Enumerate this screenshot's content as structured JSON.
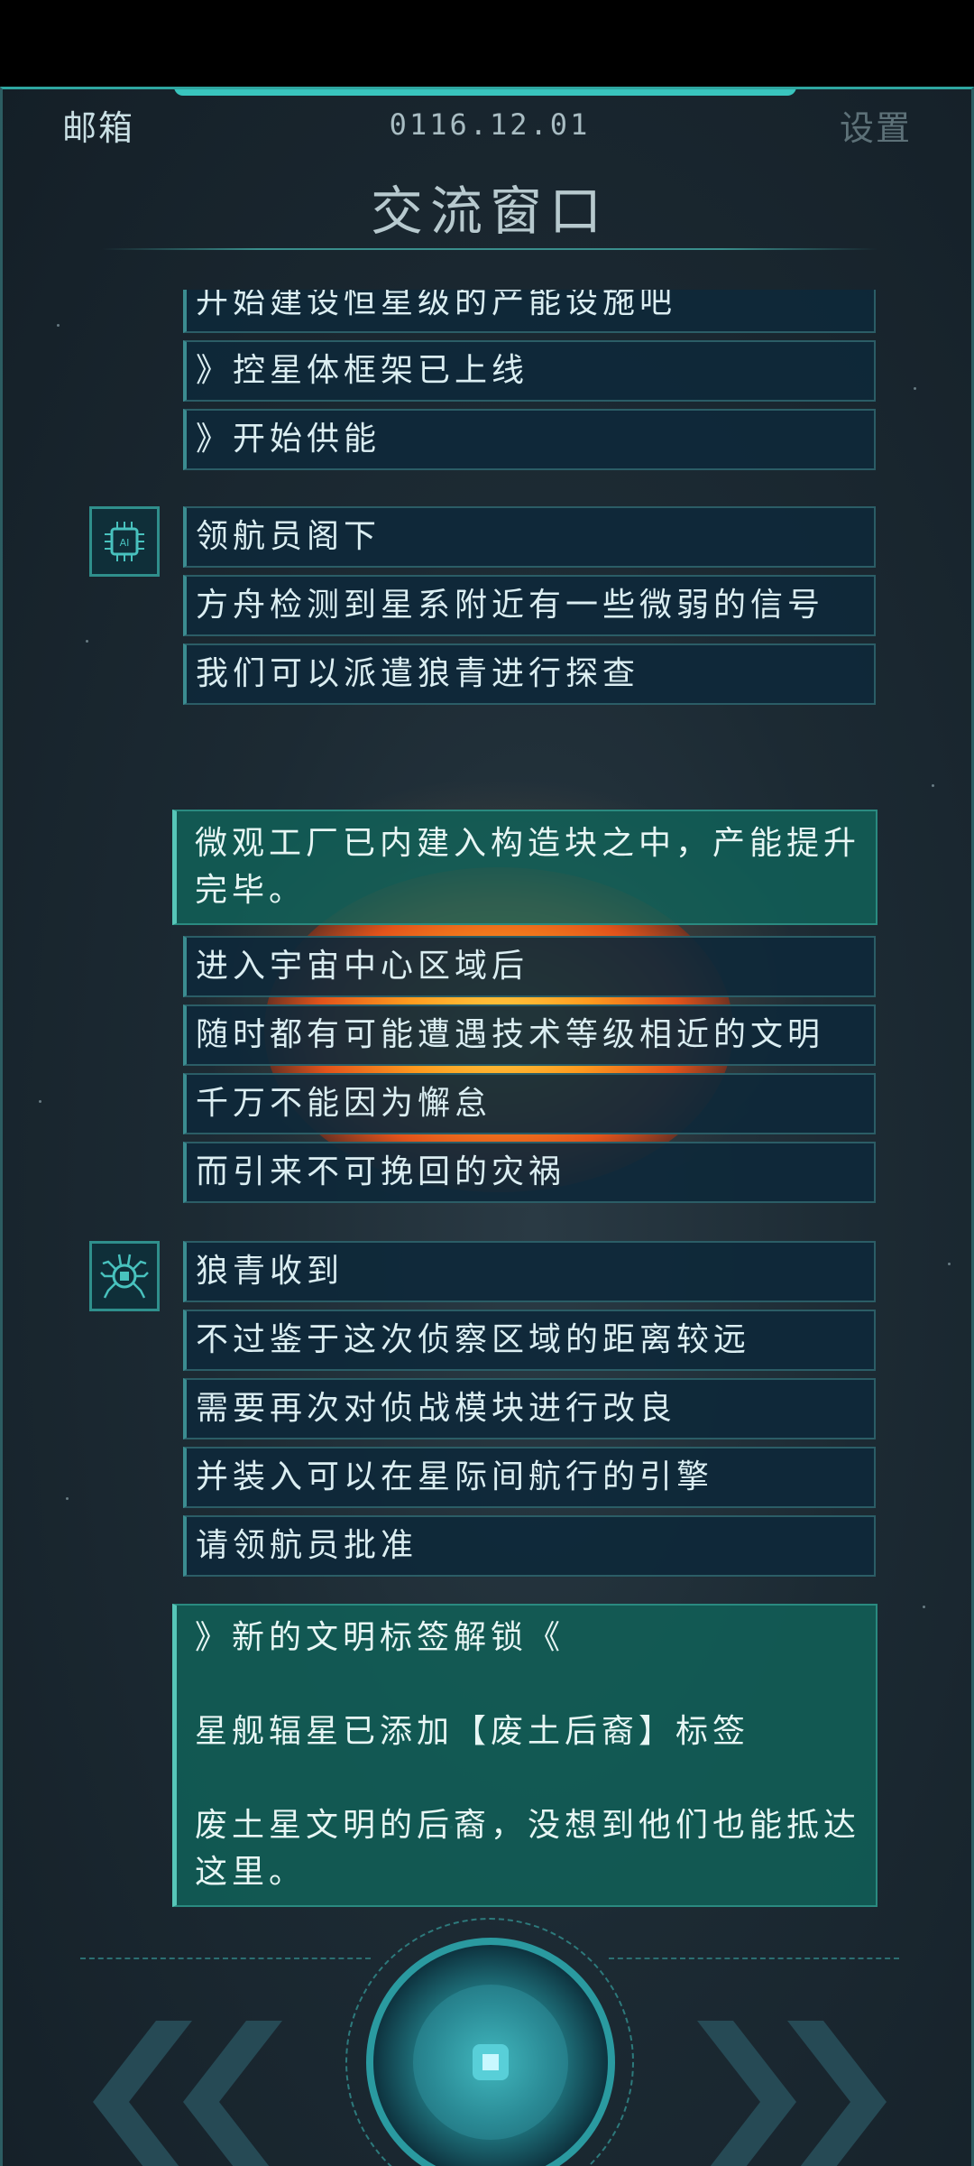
{
  "header": {
    "mailbox_label": "邮箱",
    "date": "0116.12.01",
    "settings_label": "设置",
    "title": "交流窗口"
  },
  "colors": {
    "accent_teal": "#2ea6a0",
    "message_bg": "#0e283a",
    "highlight_bg": "#106058"
  },
  "messages": {
    "group1": [
      "开始建设恒星级的产能设施吧",
      "》控星体框架已上线",
      "》开始供能"
    ],
    "group2_avatar_icon": "ai-chip-icon",
    "group2": [
      "领航员阁下",
      "方舟检测到星系附近有一些微弱的信号",
      "我们可以派遣狼青进行探查"
    ],
    "notice1": "微观工厂已内建入构造块之中，产能提升完毕。",
    "group3": [
      "进入宇宙中心区域后",
      "随时都有可能遭遇技术等级相近的文明",
      "千万不能因为懈怠",
      "而引来不可挽回的灾祸"
    ],
    "group4_avatar_icon": "spider-bot-icon",
    "group4": [
      "狼青收到",
      "不过鉴于这次侦察区域的距离较远",
      "需要再次对侦战模块进行改良",
      "并装入可以在星际间航行的引擎",
      "请领航员批准"
    ],
    "notice2": [
      "》新的文明标签解锁《",
      "星舰辐星已添加【废土后裔】标签",
      "废土星文明的后裔，没想到他们也能抵达这里。"
    ]
  },
  "footer": {
    "prev_icon": "double-chevron-left-icon",
    "center_icon": "core-button-icon",
    "next_icon": "double-chevron-right-icon"
  }
}
